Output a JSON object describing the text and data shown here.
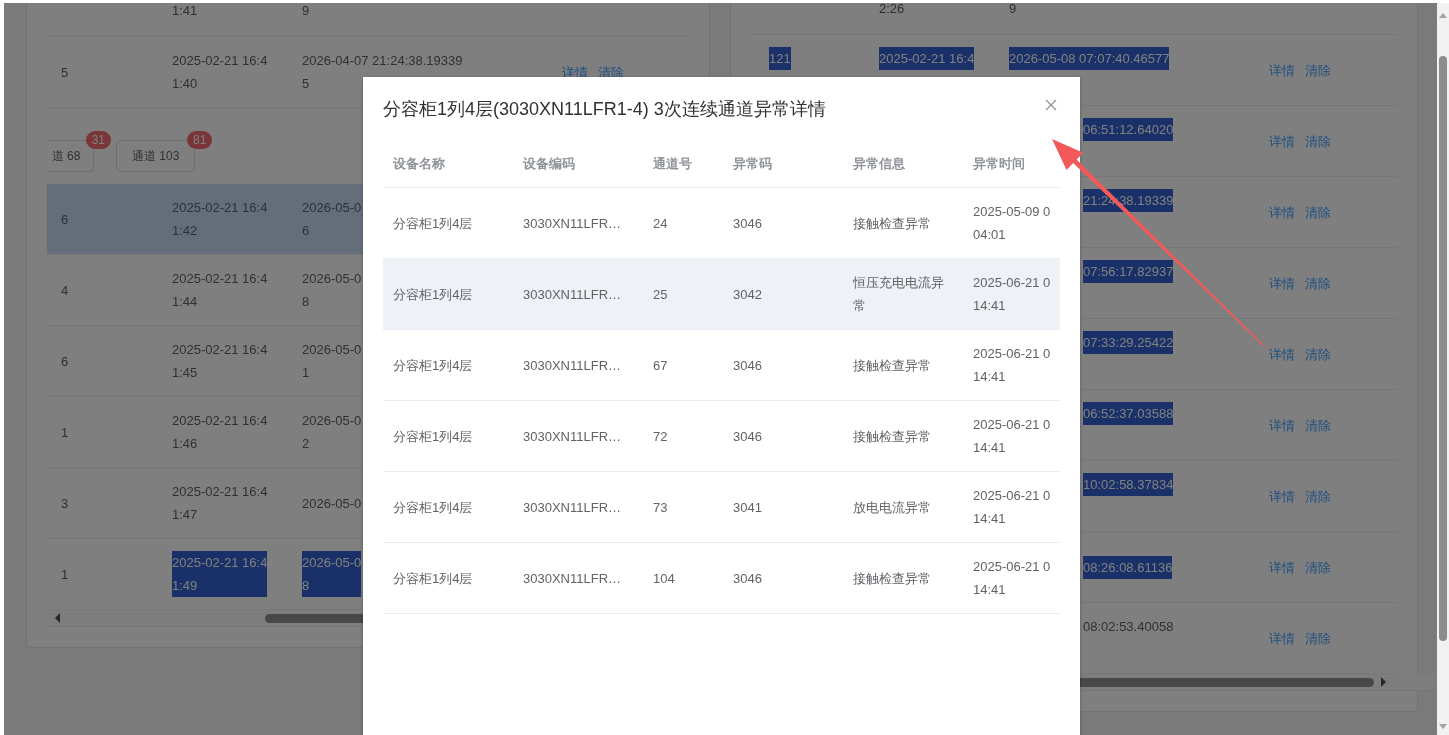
{
  "left_panel": {
    "upper_rows": [
      {
        "kind": "clipped",
        "selected": false,
        "start_time": {
          "text": "1:41",
          "highlighted": false
        },
        "end_time": {
          "text": "9",
          "highlighted": false
        }
      },
      {
        "kind": "full",
        "selected": false,
        "number": {
          "text": "5",
          "highlighted": false
        },
        "start_time": {
          "text": "2025-02-21 16:4\n1:40",
          "highlighted": false
        },
        "end_time": {
          "text": "2026-04-07 21:24:38.19339\n5",
          "highlighted": false
        },
        "actions": [
          "详情",
          "清除"
        ]
      }
    ],
    "tabs": [
      {
        "label": "道 68",
        "badge": "31"
      },
      {
        "label": "通道 103",
        "badge": "81"
      }
    ],
    "lower_rows": [
      {
        "kind": "full",
        "selected": true,
        "number": {
          "text": "6",
          "highlighted": false
        },
        "start_time": {
          "text": "2025-02-21 16:4\n1:42",
          "highlighted": false
        },
        "end_time": {
          "text": "2026-05-0\n6",
          "highlighted": false
        }
      },
      {
        "kind": "full",
        "selected": false,
        "number": {
          "text": "4",
          "highlighted": false
        },
        "start_time": {
          "text": "2025-02-21 16:4\n1:44",
          "highlighted": false
        },
        "end_time": {
          "text": "2026-05-0\n8",
          "highlighted": false
        }
      },
      {
        "kind": "full",
        "selected": false,
        "number": {
          "text": "6",
          "highlighted": false
        },
        "start_time": {
          "text": "2025-02-21 16:4\n1:45",
          "highlighted": false
        },
        "end_time": {
          "text": "2026-05-0\n1",
          "highlighted": false
        }
      },
      {
        "kind": "full",
        "selected": false,
        "number": {
          "text": "1",
          "highlighted": false
        },
        "start_time": {
          "text": "2025-02-21 16:4\n1:46",
          "highlighted": false
        },
        "end_time": {
          "text": "2026-05-0\n2",
          "highlighted": false
        }
      },
      {
        "kind": "full",
        "selected": false,
        "number": {
          "text": "3",
          "highlighted": false
        },
        "start_time": {
          "text": "2025-02-21 16:4\n1:47",
          "highlighted": false
        },
        "end_time": {
          "text": "2026-05-0",
          "highlighted": false
        }
      },
      {
        "kind": "full",
        "selected": false,
        "number": {
          "text": "1",
          "highlighted": false
        },
        "start_time": {
          "text": "2025-02-21 16:4\n1:49",
          "highlighted": true
        },
        "end_time": {
          "text": "2026-05-0\n8",
          "highlighted": true
        }
      }
    ]
  },
  "right_panel": {
    "rows": [
      {
        "kind": "clipped",
        "selected": false,
        "start_time": {
          "text": "2:26",
          "highlighted": false
        },
        "end_time": {
          "text": "9",
          "highlighted": false
        }
      },
      {
        "kind": "upper",
        "selected": false,
        "number": {
          "text": "121",
          "highlighted": true
        },
        "start_time": {
          "text": "2025-02-21 16:4",
          "highlighted": true
        },
        "end_time": {
          "text": "2026-05-08 07:07:40.46577",
          "highlighted": true
        },
        "actions": [
          "详情",
          "清除"
        ]
      },
      {
        "kind": "tail",
        "selected": false,
        "end_time": {
          "text": "06:51:12.64020",
          "highlighted": true
        },
        "actions": [
          "详情",
          "清除"
        ]
      },
      {
        "kind": "tail",
        "selected": false,
        "end_time": {
          "text": "21:24:38.19339",
          "highlighted": true
        },
        "actions": [
          "详情",
          "清除"
        ]
      },
      {
        "kind": "tail",
        "selected": false,
        "end_time": {
          "text": "07:56:17.82937",
          "highlighted": true
        },
        "actions": [
          "详情",
          "清除"
        ]
      },
      {
        "kind": "tail",
        "selected": false,
        "end_time": {
          "text": "07:33:29.25422",
          "highlighted": true
        },
        "actions": [
          "详情",
          "清除"
        ]
      },
      {
        "kind": "tail",
        "selected": false,
        "end_time": {
          "text": "06:52:37.03588",
          "highlighted": true
        },
        "actions": [
          "详情",
          "清除"
        ]
      },
      {
        "kind": "tail",
        "selected": false,
        "end_time": {
          "text": "10:02:58.37834",
          "highlighted": true
        },
        "actions": [
          "详情",
          "清除"
        ]
      },
      {
        "kind": "tailmid",
        "selected": false,
        "end_time": {
          "text": "08:26:08.61136",
          "highlighted": true
        },
        "actions": [
          "详情",
          "清除"
        ]
      },
      {
        "kind": "tail",
        "selected": false,
        "end_time": {
          "text": "08:02:53.40058",
          "highlighted": false
        },
        "actions": [
          "详情",
          "清除"
        ]
      }
    ]
  },
  "dialog": {
    "title": "分容柜1列4层(3030XN11LFR1-4) 3次连续通道异常详情",
    "columns": [
      "设备名称",
      "设备编码",
      "通道号",
      "异常码",
      "异常信息",
      "异常时间"
    ],
    "rows": [
      {
        "hovered": false,
        "cells": [
          "分容柜1列4层",
          "3030XN11LFR…",
          "24",
          "3046",
          "接触检查异常",
          "2025-05-09 0\n04:01"
        ]
      },
      {
        "hovered": true,
        "cells": [
          "分容柜1列4层",
          "3030XN11LFR…",
          "25",
          "3042",
          "恒压充电电流异常",
          "2025-06-21 0\n14:41"
        ]
      },
      {
        "hovered": false,
        "cells": [
          "分容柜1列4层",
          "3030XN11LFR…",
          "67",
          "3046",
          "接触检查异常",
          "2025-06-21 0\n14:41"
        ]
      },
      {
        "hovered": false,
        "cells": [
          "分容柜1列4层",
          "3030XN11LFR…",
          "72",
          "3046",
          "接触检查异常",
          "2025-06-21 0\n14:41"
        ]
      },
      {
        "hovered": false,
        "cells": [
          "分容柜1列4层",
          "3030XN11LFR…",
          "73",
          "3041",
          "放电电流异常",
          "2025-06-21 0\n14:41"
        ]
      },
      {
        "hovered": false,
        "cells": [
          "分容柜1列4层",
          "3030XN11LFR…",
          "104",
          "3046",
          "接触检查异常",
          "2025-06-21 0\n14:41"
        ]
      }
    ]
  }
}
